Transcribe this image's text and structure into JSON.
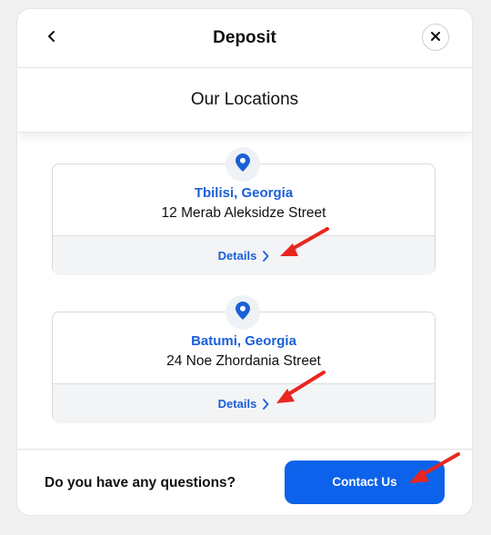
{
  "header": {
    "title": "Deposit",
    "back_icon": "chevron-left-icon",
    "close_icon": "close-icon"
  },
  "subheader": {
    "title": "Our Locations"
  },
  "locations": [
    {
      "city": "Tbilisi, Georgia",
      "street": "12 Merab Aleksidze Street",
      "details_label": "Details",
      "icon": "location-pin-icon"
    },
    {
      "city": "Batumi, Georgia",
      "street": "24 Noe Zhordania Street",
      "details_label": "Details",
      "icon": "location-pin-icon"
    }
  ],
  "footer": {
    "question": "Do you have any questions?",
    "contact_label": "Contact Us"
  },
  "colors": {
    "accent": "#1a5fd6",
    "primary_button": "#0c62ea",
    "annotation_arrow": "#e8261f"
  }
}
